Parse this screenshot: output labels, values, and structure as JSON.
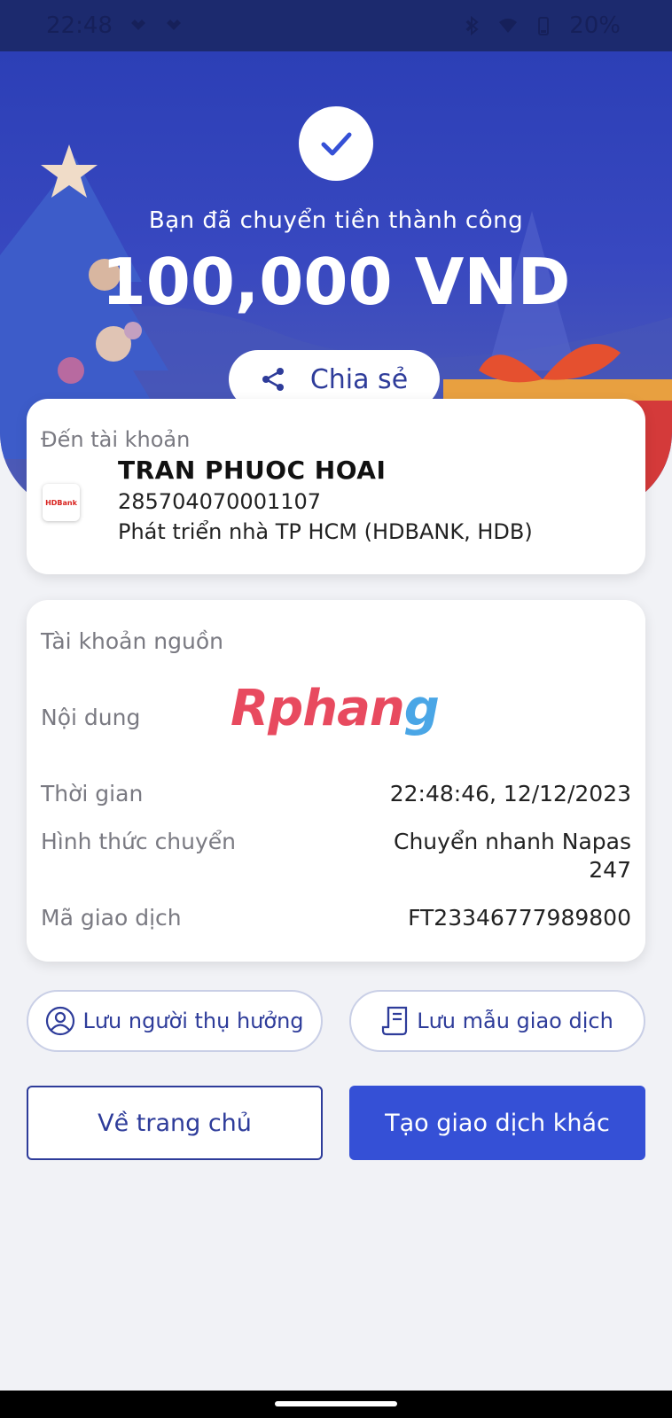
{
  "status_bar": {
    "time": "22:48",
    "battery": "20%"
  },
  "hero": {
    "title": "Bạn đã chuyển tiền thành công",
    "amount": "100,000 VND",
    "share_label": "Chia sẻ"
  },
  "recipient": {
    "label": "Đến tài khoản",
    "name": "TRAN PHUOC HOAI",
    "account": "285704070001107",
    "bank": "Phát triển nhà TP HCM (HDBANK, HDB)",
    "bank_logo_text": "HDBank"
  },
  "details": {
    "source_label": "Tài khoản nguồn",
    "content_label": "Nội dung",
    "time_label": "Thời gian",
    "time_value": "22:48:46, 12/12/2023",
    "method_label": "Hình thức chuyển",
    "method_value_line1": "Chuyển nhanh Napas",
    "method_value_line2": "247",
    "txn_label": "Mã giao dịch",
    "txn_value": "FT23346777989800"
  },
  "watermark": {
    "part1": "Rphan",
    "part2": "g"
  },
  "actions": {
    "save_payee": "Lưu người thụ hưởng",
    "save_template": "Lưu mẫu giao dịch",
    "home": "Về trang chủ",
    "new_transaction": "Tạo giao dịch khác"
  },
  "colors": {
    "primary": "#3550d6",
    "hero": "#2c3fb6",
    "text_link": "#2e3c9a"
  }
}
